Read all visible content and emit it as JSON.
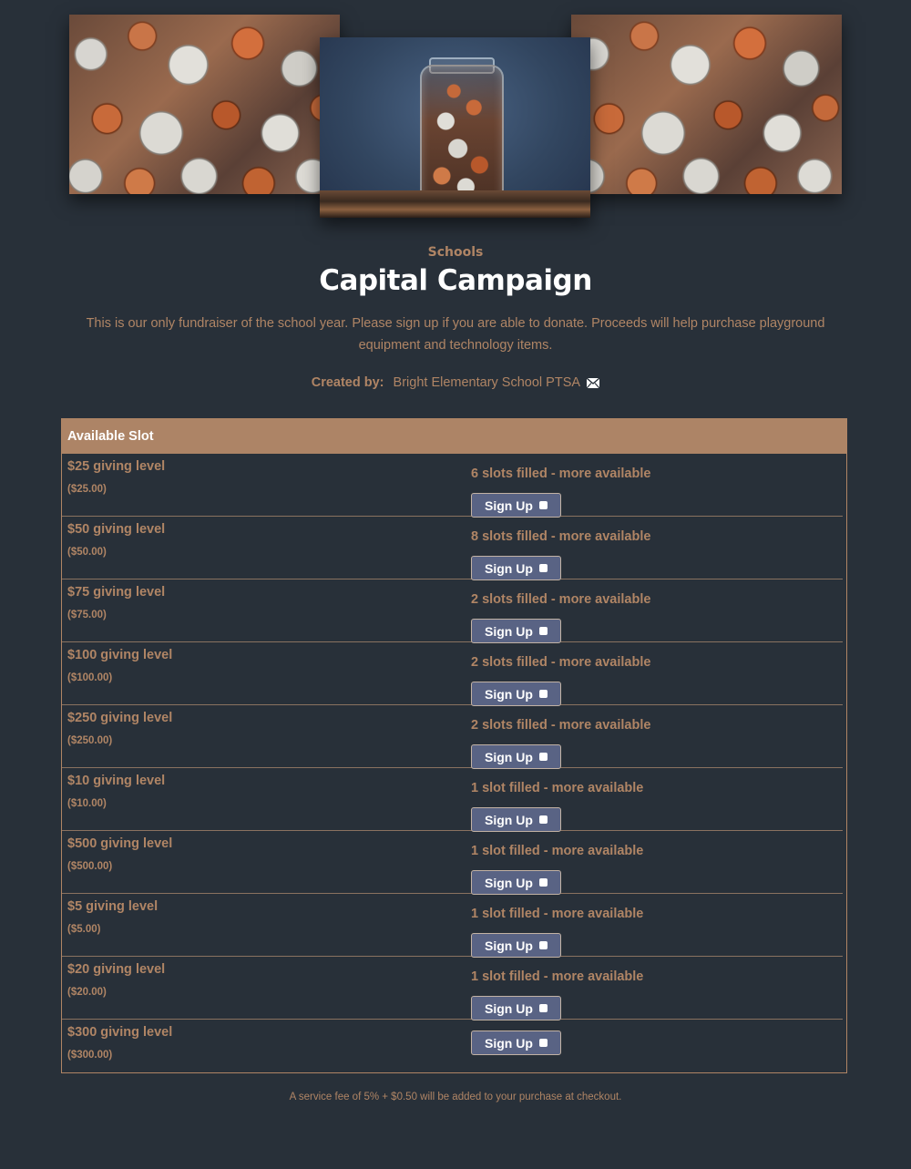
{
  "header": {
    "images": [
      {
        "name": "coins-photo-left"
      },
      {
        "name": "coin-jar-photo"
      },
      {
        "name": "coins-photo-right"
      }
    ],
    "category": "Schools",
    "title": "Capital Campaign",
    "description": "This is our only fundraiser of the school year. Please sign up if you are able to donate. Proceeds will help purchase playground equipment and technology items.",
    "created_by_label": "Created by:",
    "creator_name": "Bright Elementary School PTSA",
    "contact_icon": "envelope-icon"
  },
  "slots": {
    "header": "Available Slot",
    "signup_label": "Sign Up",
    "rows": [
      {
        "name": "$25 giving level",
        "price": "($25.00)",
        "status": "6 slots filled - more available"
      },
      {
        "name": "$50 giving level",
        "price": "($50.00)",
        "status": "8 slots filled - more available"
      },
      {
        "name": "$75 giving level",
        "price": "($75.00)",
        "status": "2 slots filled - more available"
      },
      {
        "name": "$100 giving level",
        "price": "($100.00)",
        "status": "2 slots filled - more available"
      },
      {
        "name": "$250 giving level",
        "price": "($250.00)",
        "status": "2 slots filled - more available"
      },
      {
        "name": "$10 giving level",
        "price": "($10.00)",
        "status": "1 slot filled - more available"
      },
      {
        "name": "$500 giving level",
        "price": "($500.00)",
        "status": "1 slot filled - more available"
      },
      {
        "name": "$5 giving level",
        "price": "($5.00)",
        "status": "1 slot filled - more available"
      },
      {
        "name": "$20 giving level",
        "price": "($20.00)",
        "status": "1 slot filled - more available"
      },
      {
        "name": "$300 giving level",
        "price": "($300.00)",
        "status": ""
      }
    ]
  },
  "footer": {
    "fee_note": "A service fee of 5% + $0.50 will be added to your purchase at checkout."
  },
  "colors": {
    "background": "#283039",
    "accent": "#b08565",
    "header_bar": "#ad8466",
    "button": "#596384"
  }
}
